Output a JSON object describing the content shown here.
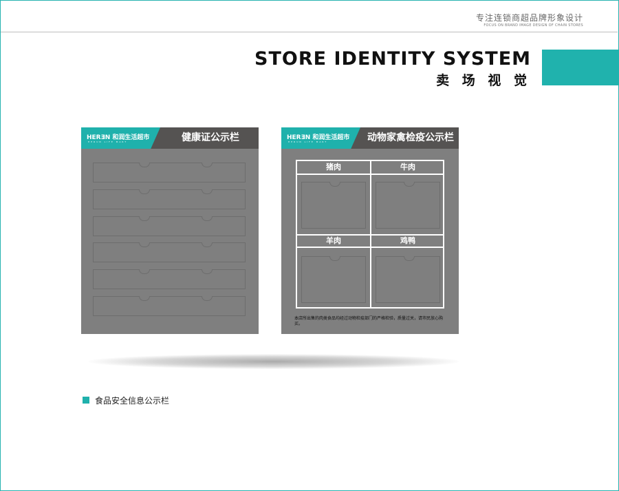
{
  "header": {
    "tagline_cn": "专注连锁商超品牌形象设计",
    "tagline_en": "FOCUS ON BRAND IMAGE DESIGN OF CHAIN STORES"
  },
  "section": {
    "title_en": "STORE IDENTITY SYSTEM",
    "title_cn": "卖 场 视 觉"
  },
  "brand": {
    "logo_text": "HERƎN 和润生活超市",
    "logo_sub": "HERUN LIFE MART",
    "accent_color": "#1fb1ac",
    "dark_color": "#555352",
    "board_color": "#7f7f7f"
  },
  "board_a": {
    "title": "健康证公示栏"
  },
  "board_b": {
    "title": "动物家禽检疫公示栏",
    "cells": [
      "猪肉",
      "牛肉",
      "羊肉",
      "鸡鸭"
    ],
    "footnote": "本店所出售的肉类食品均经过动物检疫部门的严格检验，质量过关，请市民放心购买。"
  },
  "caption": "食品安全信息公示栏"
}
